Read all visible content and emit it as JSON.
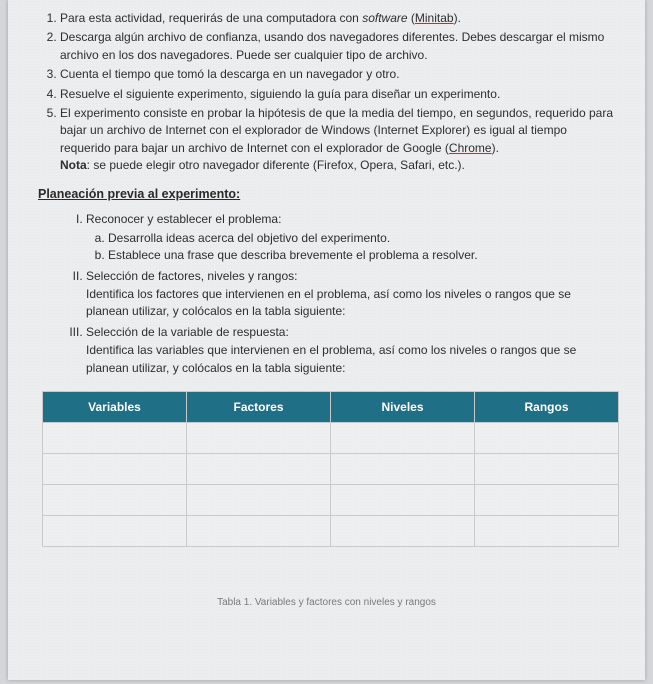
{
  "steps": [
    {
      "pre": "Para esta actividad, requerirás de una computadora con ",
      "italic": "software",
      "mid": " (",
      "ulink": "Minitab",
      "post": ")."
    },
    {
      "text": "Descarga algún archivo de confianza, usando dos navegadores diferentes. Debes descargar el mismo archivo en los dos navegadores. Puede ser cualquier tipo de archivo."
    },
    {
      "text": "Cuenta el tiempo que tomó la descarga en un navegador y otro."
    },
    {
      "text": "Resuelve el siguiente experimento, siguiendo la guía para diseñar un experimento."
    },
    {
      "text": "El experimento consiste en probar la hipótesis de que la media del tiempo, en segundos, requerido para bajar un archivo de Internet con el explorador de Windows (Internet Explorer) es igual al tiempo requerido para bajar un archivo de Internet con el explorador de Google (",
      "ulink": "Chrome",
      "post": ").",
      "noteLabel": "Nota",
      "noteText": ": se puede elegir otro navegador diferente (Firefox, Opera, Safari, etc.)."
    }
  ],
  "sectionTitle": "Planeación previa al experimento:",
  "roman": [
    {
      "title": "Reconocer y establecer el problema:",
      "alpha": [
        "Desarrolla ideas acerca del objetivo del experimento.",
        "Establece una frase que describa brevemente el problema a resolver."
      ]
    },
    {
      "title": "Selección de factores, niveles y rangos:",
      "sub": "Identifica los factores que intervienen en el problema, así como los niveles o rangos que se planean utilizar, y colócalos en la tabla siguiente:"
    },
    {
      "title": "Selección de la variable de respuesta:",
      "sub": "Identifica las variables que intervienen en el problema, así como los niveles o rangos que se planean utilizar, y colócalos en la tabla siguiente:"
    }
  ],
  "table": {
    "headers": [
      "Variables",
      "Factores",
      "Niveles",
      "Rangos"
    ],
    "rows": 4
  },
  "caption": "Tabla 1. Variables y factores con niveles y rangos"
}
